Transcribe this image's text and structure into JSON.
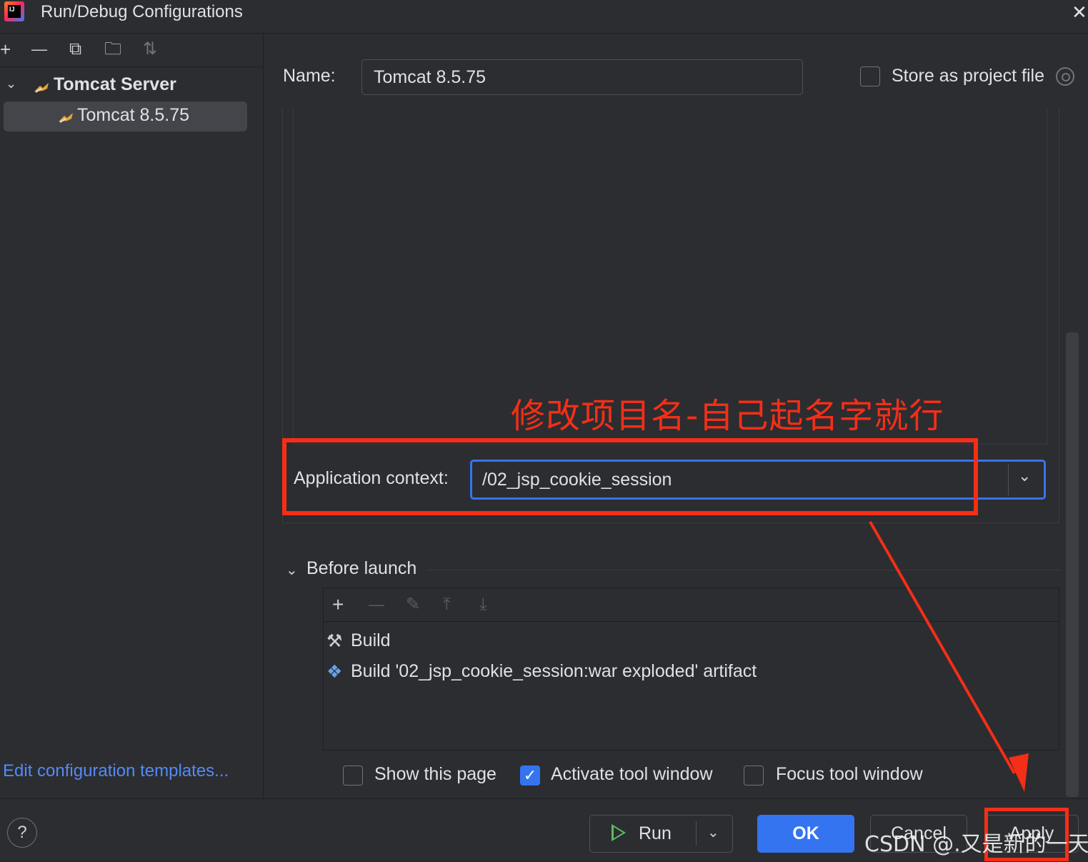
{
  "window": {
    "title": "Run/Debug Configurations",
    "close_symbol": "✕",
    "app_logo_text": "IJ"
  },
  "left_toolbar": {
    "add_symbol": "+",
    "remove_symbol": "—",
    "copy_symbol": "⧉",
    "folder_symbol": "🗀",
    "sort_symbol": "⇅",
    "icons": [
      "plus-icon",
      "minus-icon",
      "copy-icon",
      "new-folder-icon",
      "sort-icon"
    ]
  },
  "tree": {
    "chevron": "⌄",
    "group_label": "Tomcat Server",
    "items": [
      {
        "label": "Tomcat 8.5.75",
        "selected": true
      }
    ]
  },
  "edit_templates_link": "Edit configuration templates...",
  "form": {
    "name_label": "Name:",
    "name_value": "Tomcat 8.5.75",
    "store_label": "Store as project file",
    "store_checked": false,
    "app_context_label": "Application context:",
    "app_context_value": "/02_jsp_cookie_session",
    "combo_arrow": "⌄"
  },
  "annotation": {
    "text": "修改项目名-自己起名字就行",
    "color": "#f42e18"
  },
  "before_launch": {
    "chevron": "⌄",
    "label": "Before launch",
    "toolbar": {
      "add": "+",
      "remove": "—",
      "edit": "✎",
      "up": "⤒",
      "down": "⤓"
    },
    "tasks": [
      {
        "icon": "build-hammer-icon",
        "glyph": "⚒",
        "label": "Build"
      },
      {
        "icon": "artifact-icon",
        "glyph": "❖",
        "label": "Build '02_jsp_cookie_session:war exploded' artifact"
      }
    ]
  },
  "options": [
    {
      "label": "Show this page",
      "checked": false
    },
    {
      "label": "Activate tool window",
      "checked": true,
      "check_glyph": "✓"
    },
    {
      "label": "Focus tool window",
      "checked": false
    }
  ],
  "buttons": {
    "help": "?",
    "run": "Run",
    "run_dropdown": "⌄",
    "ok": "OK",
    "cancel": "Cancel",
    "apply": "Apply"
  },
  "watermark": "CSDN @.又是新的一天.",
  "colors": {
    "accent": "#3574f0",
    "background": "#2b2d30",
    "annotation_red": "#f42e18",
    "link": "#548af7",
    "run_green": "#5fb865"
  }
}
